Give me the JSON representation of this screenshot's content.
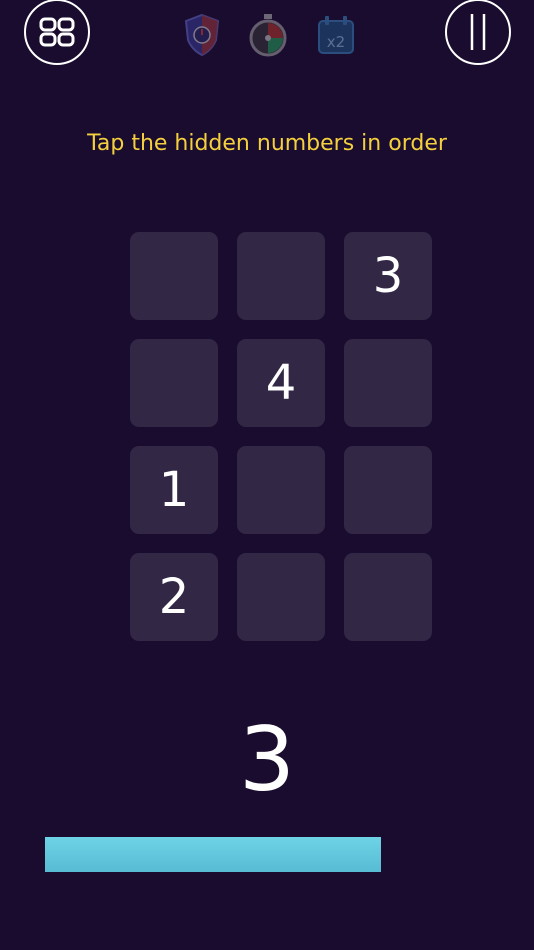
{
  "header": {
    "menu_icon": "grid-menu-icon",
    "pause_icon": "pause-icon",
    "powerups": [
      {
        "name": "shield-powerup",
        "icon": "shield-icon"
      },
      {
        "name": "stopwatch-powerup",
        "icon": "stopwatch-icon"
      },
      {
        "name": "double-points-powerup",
        "icon": "calendar-x2-icon",
        "label": "x2"
      }
    ]
  },
  "instruction": "Tap the hidden numbers in order",
  "grid": {
    "rows": 4,
    "cols": 3,
    "tiles": [
      "",
      "",
      "3",
      "",
      "4",
      "",
      "1",
      "",
      "",
      "2",
      "",
      ""
    ]
  },
  "current_number": "3",
  "timer": {
    "remaining_fraction": 0.63
  },
  "colors": {
    "background": "#1a0c2e",
    "tile": "#322845",
    "instruction": "#f4d03f",
    "timer_bar": "#6fd3e6"
  }
}
